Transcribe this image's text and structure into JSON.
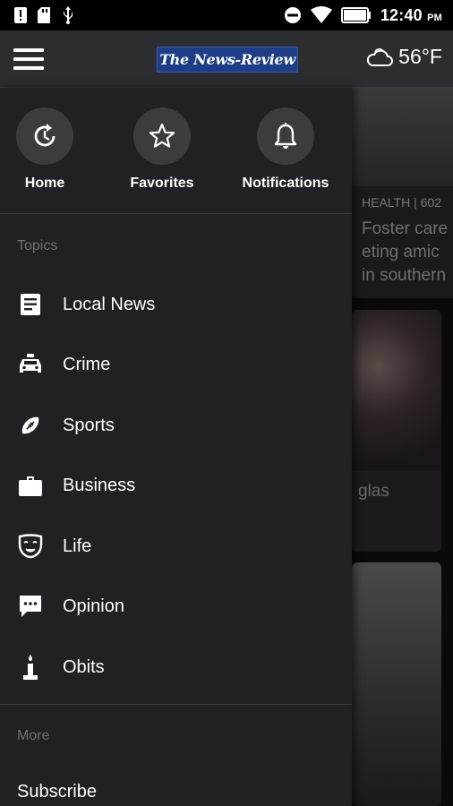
{
  "status_bar": {
    "time": "12:40",
    "ampm": "PM",
    "battery_text": "100",
    "left_icons": [
      "alert-icon",
      "sd-card-icon",
      "usb-icon"
    ],
    "right_icons": [
      "do-not-disturb-icon",
      "wifi-icon",
      "battery-icon"
    ]
  },
  "app_bar": {
    "logo_text": "The News-Review",
    "weather_temp": "56°F",
    "weather_icon": "cloud-icon"
  },
  "drawer": {
    "quick_links": [
      {
        "label": "Home",
        "icon": "home-refresh-icon"
      },
      {
        "label": "Favorites",
        "icon": "star-icon"
      },
      {
        "label": "Notifications",
        "icon": "bell-icon"
      }
    ],
    "topics_label": "Topics",
    "topics": [
      {
        "label": "Local News",
        "icon": "article-icon"
      },
      {
        "label": "Crime",
        "icon": "police-car-icon"
      },
      {
        "label": "Sports",
        "icon": "football-icon"
      },
      {
        "label": "Business",
        "icon": "briefcase-icon"
      },
      {
        "label": "Life",
        "icon": "theater-mask-icon"
      },
      {
        "label": "Opinion",
        "icon": "comment-icon"
      },
      {
        "label": "Obits",
        "icon": "candle-icon"
      }
    ],
    "more_label": "More",
    "more_items": [
      {
        "label": "Subscribe"
      }
    ]
  },
  "background_feed": {
    "card1_category": "HEALTH | 602",
    "card1_headline_lines": [
      "Foster care",
      "eting amic",
      "in southern"
    ],
    "card2_headline": "glas"
  },
  "colors": {
    "drawer_bg": "#202124",
    "app_bar_bg": "#2b2d30",
    "logo_bg": "#1d3d86",
    "circle_bg": "#3b3c40",
    "muted_text": "#6f7075"
  }
}
